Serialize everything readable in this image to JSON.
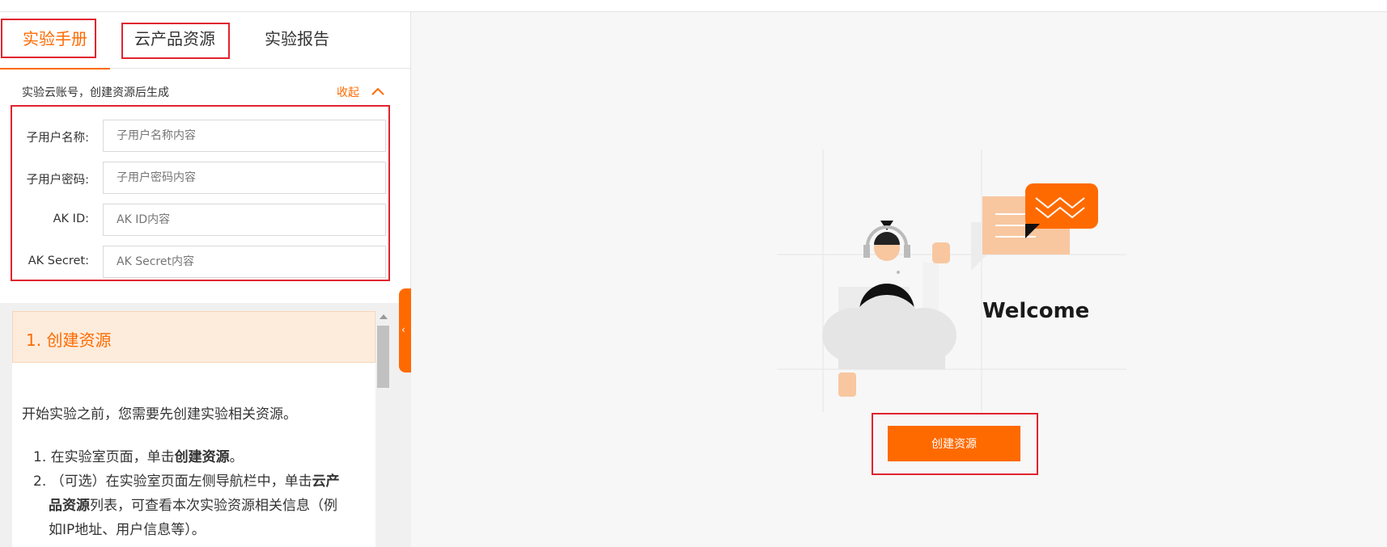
{
  "tabs": [
    {
      "label": "实验手册",
      "active": true
    },
    {
      "label": "云产品资源",
      "active": false
    },
    {
      "label": "实验报告",
      "active": false
    }
  ],
  "account": {
    "heading": "实验云账号，创建资源后生成",
    "collapse_label": "收起",
    "fields": [
      {
        "label": "子用户名称:",
        "placeholder": "子用户名称内容"
      },
      {
        "label": "子用户密码:",
        "placeholder": "子用户密码内容"
      },
      {
        "label": "AK ID:",
        "placeholder": "AK ID内容"
      },
      {
        "label": "AK Secret:",
        "placeholder": "AK Secret内容"
      }
    ]
  },
  "manual": {
    "step_title": "1. 创建资源",
    "intro": "开始实验之前，您需要先创建实验相关资源。",
    "item1_prefix": "在实验室页面，单击",
    "item1_bold": "创建资源",
    "item1_suffix": "。",
    "item2_line1_prefix": "（可选）在实验室页面左侧导航栏中，单击",
    "item2_line1_bold": "云产",
    "item2_line2_bold": "品资源",
    "item2_line2_suffix": "列表，可查看本次实验资源相关信息（例",
    "item2_line3": "如IP地址、用户信息等）。"
  },
  "main": {
    "welcome": "Welcome",
    "create_button": "创建资源"
  },
  "colors": {
    "accent": "#ff6a00",
    "highlight_box": "#e0242f"
  },
  "icons": [
    "chevron-up-icon",
    "chevron-left-icon",
    "welcome-illustration"
  ]
}
